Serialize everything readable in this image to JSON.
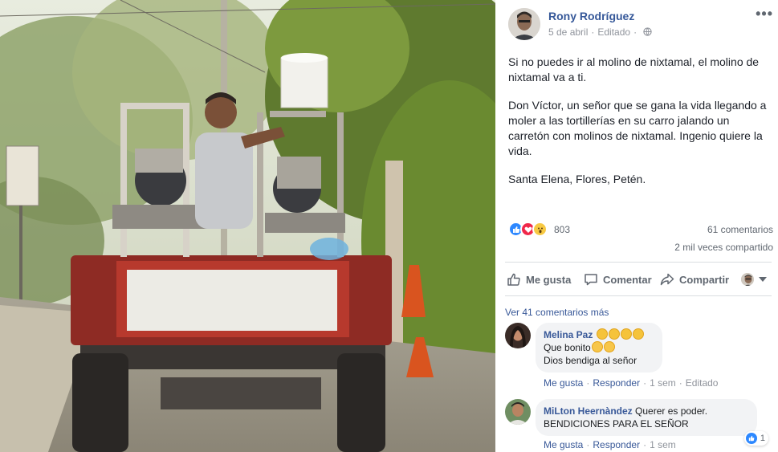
{
  "post": {
    "author": "Rony Rodríguez",
    "date": "5 de abril",
    "edited": "Editado",
    "more_label": "•••",
    "paragraphs": [
      "Si no puedes ir al molino de nixtamal, el molino de nixtamal va a ti.",
      "Don Víctor, un señor que se gana la vida llegando a moler a las tortillerías en su carro jalando un carretón con molinos de nixtamal. Ingenio quiere la vida.",
      "Santa Elena, Flores, Petén."
    ]
  },
  "stats": {
    "reaction_icons": [
      "like-icon",
      "love-icon",
      "wow-icon"
    ],
    "reactions_count": "803",
    "comments": "61 comentarios",
    "shares": "2 mil veces compartido"
  },
  "actions": {
    "like": "Me gusta",
    "comment": "Comentar",
    "share": "Compartir"
  },
  "comments": {
    "view_more": "Ver 41 comentarios más",
    "items": [
      {
        "name": "Melina Paz",
        "line1": "Que bonito",
        "line2": "Dios bendiga al señor",
        "like": "Me gusta",
        "reply": "Responder",
        "time": "1 sem",
        "edited": "Editado"
      },
      {
        "name": "MiLton Heernàndez",
        "line1": "Querer es poder.",
        "line2": "BENDICIONES PARA EL SEÑOR",
        "like": "Me gusta",
        "reply": "Responder",
        "time": "1 sem",
        "reactions": "1"
      }
    ]
  },
  "colors": {
    "link_blue": "#385898",
    "author_blue": "#365899",
    "like_blue": "#2d88ff",
    "love_red": "#f0284a",
    "wow_yellow": "#f7c943",
    "bubble_bg": "#f2f3f5"
  }
}
